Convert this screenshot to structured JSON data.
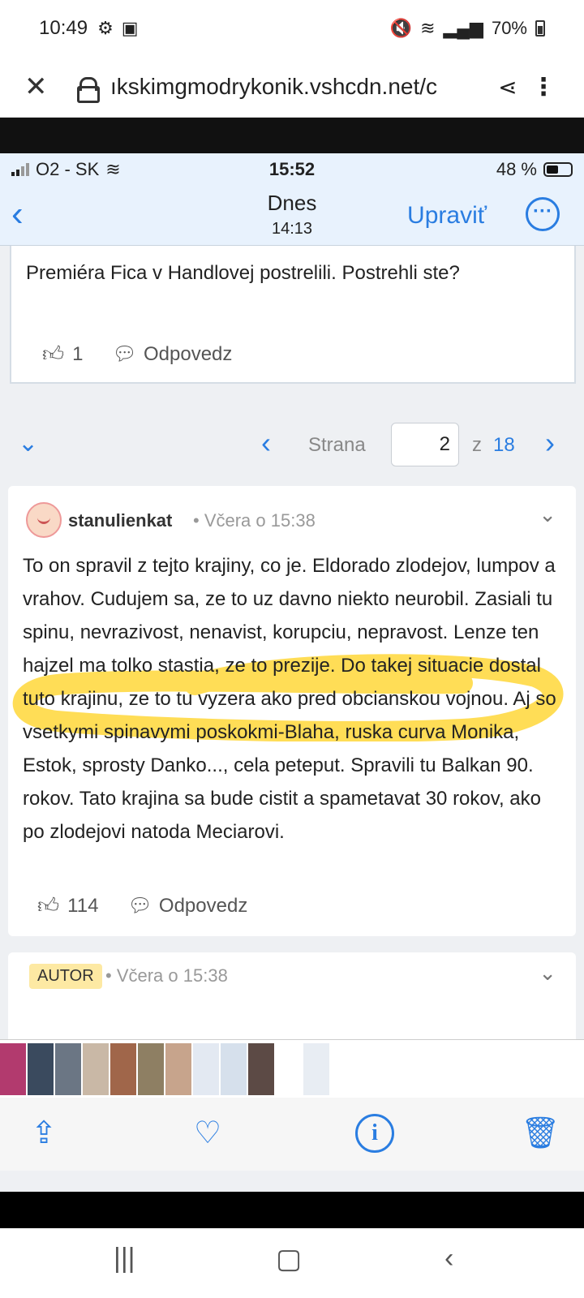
{
  "android_status": {
    "time": "10:49",
    "battery": "70%"
  },
  "browser": {
    "url": "ıkskimgmodrykonik.vshcdn.net/c"
  },
  "ios_status": {
    "carrier": "O2 - SK",
    "time": "15:52",
    "battery": "48 %"
  },
  "ios_nav": {
    "title": "Dnes",
    "subtitle": "14:13",
    "edit": "Upraviť"
  },
  "post1": {
    "text": "Premiéra Fica v Handlovej postrelili. Postrehli ste?",
    "likes": "1",
    "reply": "Odpovedz"
  },
  "pager": {
    "label": "Strana",
    "current": "2",
    "of": "z",
    "total": "18"
  },
  "comment1": {
    "user": "stanulienkat",
    "meta": "• Včera o 15:38",
    "body": "To on spravil z tejto krajiny, co je. Eldorado zlodejov, lumpov a vrahov. Cudujem sa, ze to uz davno niekto neurobil. Zasiali tu spinu, nevrazivost, nenavist, korupciu, nepravost. Lenze ten hajzel ma tolko stastia, ze to prezije. Do takej situacie dostal tuto krajinu, ze to tu vyzera ako pred obcianskou vojnou. Aj so vsetkymi spinavymi poskokmi-Blaha, ruska curva Monika, Estok, sprosty Danko..., cela peteput. Spravili tu Balkan 90. rokov. Tato krajina sa bude cistit a spametavat 30 rokov, ako po zlodejovi natoda Meciarovi.",
    "likes": "114",
    "reply": "Odpovedz"
  },
  "comment2": {
    "badge": "AUTOR",
    "meta": "• Včera o 15:38"
  },
  "colors": {
    "accent": "#2a7de1",
    "highlight": "#ffd21e",
    "badge": "#fde9a3"
  },
  "icons": [
    "close-icon",
    "lock-icon",
    "share-icon",
    "more-icon",
    "back-chevron-icon",
    "ellipsis-icon",
    "like-icon",
    "reply-icon",
    "share-upload-icon",
    "heart-icon",
    "info-icon",
    "trash-icon"
  ]
}
